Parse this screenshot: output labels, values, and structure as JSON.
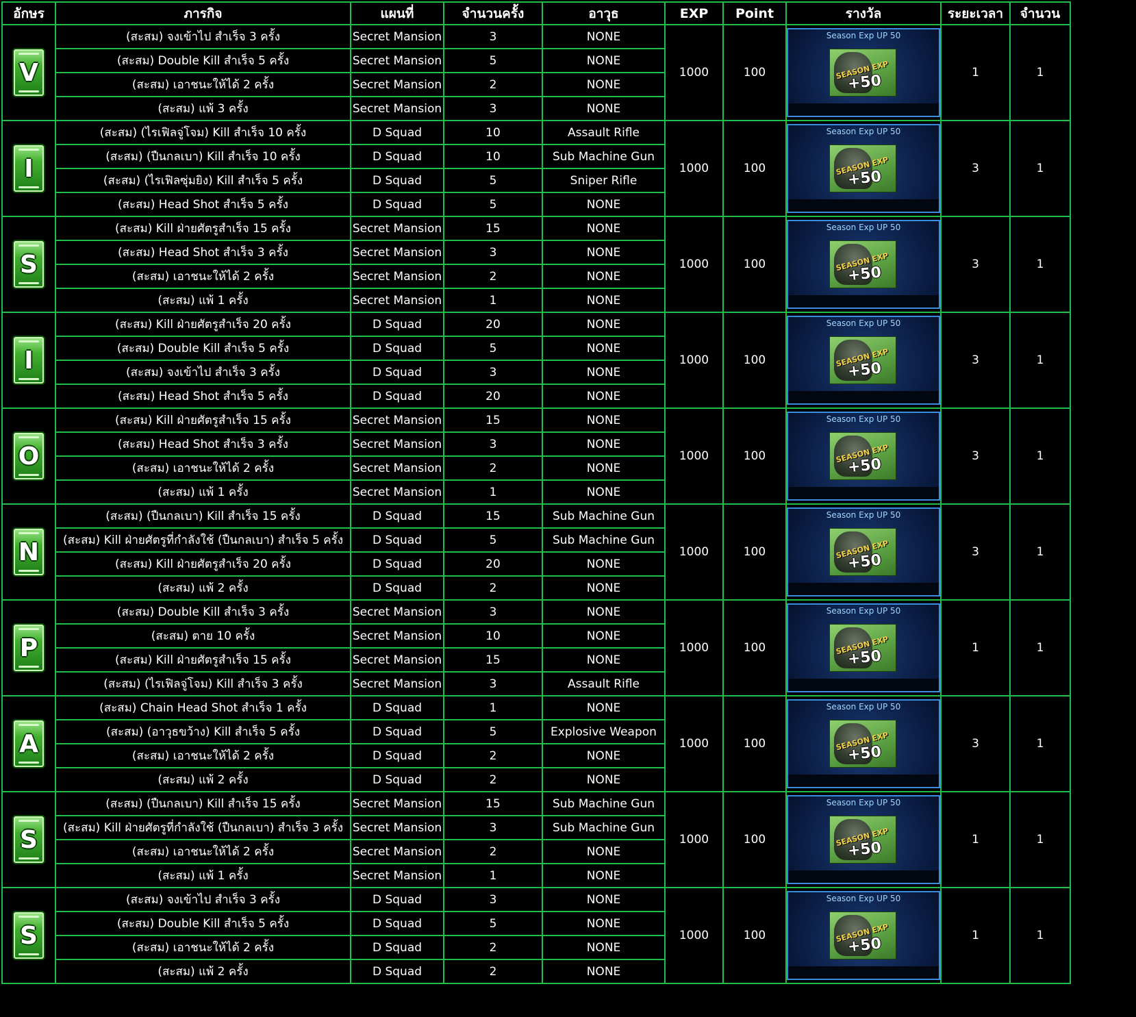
{
  "headers": [
    "อักษร",
    "ภารกิจ",
    "แผนที่",
    "จำนวนครั้ง",
    "อาวุธ",
    "EXP",
    "Point",
    "รางวัล",
    "ระยะเวลา",
    "จำนวน"
  ],
  "reward": {
    "title": "Season Exp UP 50",
    "art_text": "SEASON EXP",
    "art_plus": "+50"
  },
  "colors": {
    "border": "#1fbf4a",
    "background": "#000000",
    "badge_green": "#42b02f",
    "reward_border": "#3a8de0"
  },
  "groups": [
    {
      "letter": "V",
      "exp": "1000",
      "point": "100",
      "duration": "1",
      "count": "1",
      "rows": [
        {
          "task": "(สะสม) จงเข้าไป สำเร็จ 3 ครั้ง",
          "map": "Secret Mansion",
          "times": "3",
          "weapon": "NONE"
        },
        {
          "task": "(สะสม) Double Kill สำเร็จ 5 ครั้ง",
          "map": "Secret Mansion",
          "times": "5",
          "weapon": "NONE"
        },
        {
          "task": "(สะสม) เอาชนะให้ได้ 2 ครั้ง",
          "map": "Secret Mansion",
          "times": "2",
          "weapon": "NONE"
        },
        {
          "task": "(สะสม) แพ้ 3 ครั้ง",
          "map": "Secret Mansion",
          "times": "3",
          "weapon": "NONE"
        }
      ]
    },
    {
      "letter": "I",
      "exp": "1000",
      "point": "100",
      "duration": "3",
      "count": "1",
      "rows": [
        {
          "task": "(สะสม) (ไรเฟิลจู่โจม) Kill  สำเร็จ 10 ครั้ง",
          "map": "D Squad",
          "times": "10",
          "weapon": "Assault Rifle"
        },
        {
          "task": "(สะสม) (ปืนกลเบา) Kill  สำเร็จ 10 ครั้ง",
          "map": "D Squad",
          "times": "10",
          "weapon": "Sub Machine Gun"
        },
        {
          "task": "(สะสม) (ไรเฟิลซุ่มยิง) Kill สำเร็จ 5 ครั้ง",
          "map": "D Squad",
          "times": "5",
          "weapon": "Sniper Rifle"
        },
        {
          "task": "(สะสม) Head Shot สำเร็จ 5 ครั้ง",
          "map": "D Squad",
          "times": "5",
          "weapon": "NONE"
        }
      ]
    },
    {
      "letter": "S",
      "exp": "1000",
      "point": "100",
      "duration": "3",
      "count": "1",
      "rows": [
        {
          "task": "(สะสม) Kill ฝ่ายศัตรูสำเร็จ 15 ครั้ง",
          "map": "Secret Mansion",
          "times": "15",
          "weapon": "NONE"
        },
        {
          "task": "(สะสม) Head Shot สำเร็จ 3 ครั้ง",
          "map": "Secret Mansion",
          "times": "3",
          "weapon": "NONE"
        },
        {
          "task": "(สะสม) เอาชนะให้ได้ 2 ครั้ง",
          "map": "Secret Mansion",
          "times": "2",
          "weapon": "NONE"
        },
        {
          "task": "(สะสม) แพ้ 1 ครั้ง",
          "map": "Secret Mansion",
          "times": "1",
          "weapon": "NONE"
        }
      ]
    },
    {
      "letter": "I",
      "exp": "1000",
      "point": "100",
      "duration": "3",
      "count": "1",
      "rows": [
        {
          "task": "(สะสม) Kill ฝ่ายศัตรูสำเร็จ 20 ครั้ง",
          "map": "D Squad",
          "times": "20",
          "weapon": "NONE"
        },
        {
          "task": "(สะสม) Double Kill สำเร็จ 5 ครั้ง",
          "map": "D Squad",
          "times": "5",
          "weapon": "NONE"
        },
        {
          "task": "(สะสม) จงเข้าไป สำเร็จ 3 ครั้ง",
          "map": "D Squad",
          "times": "3",
          "weapon": "NONE"
        },
        {
          "task": "(สะสม) Head Shot สำเร็จ 5 ครั้ง",
          "map": "D Squad",
          "times": "20",
          "weapon": "NONE"
        }
      ]
    },
    {
      "letter": "O",
      "exp": "1000",
      "point": "100",
      "duration": "3",
      "count": "1",
      "rows": [
        {
          "task": "(สะสม) Kill ฝ่ายศัตรูสำเร็จ 15 ครั้ง",
          "map": "Secret Mansion",
          "times": "15",
          "weapon": "NONE"
        },
        {
          "task": "(สะสม) Head Shot สำเร็จ 3 ครั้ง",
          "map": "Secret Mansion",
          "times": "3",
          "weapon": "NONE"
        },
        {
          "task": "(สะสม) เอาชนะให้ได้ 2 ครั้ง",
          "map": "Secret Mansion",
          "times": "2",
          "weapon": "NONE"
        },
        {
          "task": "(สะสม) แพ้ 1 ครั้ง",
          "map": "Secret Mansion",
          "times": "1",
          "weapon": "NONE"
        }
      ]
    },
    {
      "letter": "N",
      "exp": "1000",
      "point": "100",
      "duration": "3",
      "count": "1",
      "rows": [
        {
          "task": "(สะสม) (ปืนกลเบา) Kill  สำเร็จ 15 ครั้ง",
          "map": "D Squad",
          "times": "15",
          "weapon": "Sub Machine Gun"
        },
        {
          "task": "(สะสม) Kill ฝ่ายศัตรูที่กำลังใช้ (ปืนกลเบา) สำเร็จ 5 ครั้ง",
          "map": "D Squad",
          "times": "5",
          "weapon": "Sub Machine Gun"
        },
        {
          "task": "(สะสม) Kill ฝ่ายศัตรูสำเร็จ 20 ครั้ง",
          "map": "D Squad",
          "times": "20",
          "weapon": "NONE"
        },
        {
          "task": "(สะสม) แพ้ 2 ครั้ง",
          "map": "D Squad",
          "times": "2",
          "weapon": "NONE"
        }
      ]
    },
    {
      "letter": "P",
      "exp": "1000",
      "point": "100",
      "duration": "1",
      "count": "1",
      "rows": [
        {
          "task": "(สะสม) Double Kill สำเร็จ 3 ครั้ง",
          "map": "Secret Mansion",
          "times": "3",
          "weapon": "NONE"
        },
        {
          "task": "(สะสม) ตาย 10 ครั้ง",
          "map": "Secret Mansion",
          "times": "10",
          "weapon": "NONE"
        },
        {
          "task": "(สะสม) Kill ฝ่ายศัตรูสำเร็จ 15 ครั้ง",
          "map": "Secret Mansion",
          "times": "15",
          "weapon": "NONE"
        },
        {
          "task": "(สะสม) (ไรเฟิลจู่โจม) Kill  สำเร็จ 3 ครั้ง",
          "map": "Secret Mansion",
          "times": "3",
          "weapon": "Assault Rifle"
        }
      ]
    },
    {
      "letter": "A",
      "exp": "1000",
      "point": "100",
      "duration": "3",
      "count": "1",
      "rows": [
        {
          "task": "(สะสม) Chain Head Shot สำเร็จ 1 ครั้ง",
          "map": "D Squad",
          "times": "1",
          "weapon": "NONE"
        },
        {
          "task": "(สะสม) (อาวุธขว้าง) Kill สำเร็จ 5 ครั้ง",
          "map": "D Squad",
          "times": "5",
          "weapon": "Explosive Weapon"
        },
        {
          "task": "(สะสม) เอาชนะให้ได้ 2 ครั้ง",
          "map": "D Squad",
          "times": "2",
          "weapon": "NONE"
        },
        {
          "task": "(สะสม) แพ้ 2 ครั้ง",
          "map": "D Squad",
          "times": "2",
          "weapon": "NONE"
        }
      ]
    },
    {
      "letter": "S",
      "exp": "1000",
      "point": "100",
      "duration": "1",
      "count": "1",
      "rows": [
        {
          "task": "(สะสม) (ปืนกลเบา) Kill  สำเร็จ 15 ครั้ง",
          "map": "Secret Mansion",
          "times": "15",
          "weapon": "Sub Machine Gun"
        },
        {
          "task": "(สะสม) Kill ฝ่ายศัตรูที่กำลังใช้ (ปืนกลเบา) สำเร็จ 3 ครั้ง",
          "map": "Secret Mansion",
          "times": "3",
          "weapon": "Sub Machine Gun"
        },
        {
          "task": "(สะสม) เอาชนะให้ได้ 2 ครั้ง",
          "map": "Secret Mansion",
          "times": "2",
          "weapon": "NONE"
        },
        {
          "task": "(สะสม) แพ้ 1 ครั้ง",
          "map": "Secret Mansion",
          "times": "1",
          "weapon": "NONE"
        }
      ]
    },
    {
      "letter": "S",
      "exp": "1000",
      "point": "100",
      "duration": "1",
      "count": "1",
      "rows": [
        {
          "task": "(สะสม) จงเข้าไป สำเร็จ 3 ครั้ง",
          "map": "D Squad",
          "times": "3",
          "weapon": "NONE"
        },
        {
          "task": "(สะสม) Double Kill สำเร็จ 5 ครั้ง",
          "map": "D Squad",
          "times": "5",
          "weapon": "NONE"
        },
        {
          "task": "(สะสม) เอาชนะให้ได้ 2 ครั้ง",
          "map": "D Squad",
          "times": "2",
          "weapon": "NONE"
        },
        {
          "task": "(สะสม) แพ้ 2 ครั้ง",
          "map": "D Squad",
          "times": "2",
          "weapon": "NONE"
        }
      ]
    }
  ]
}
